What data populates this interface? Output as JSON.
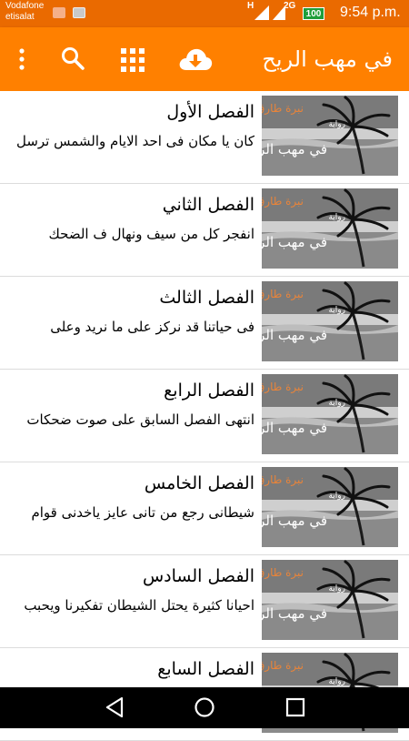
{
  "status_bar": {
    "carrier_line1": "Vodafone",
    "carrier_line2": "etisalat",
    "network_h": "H",
    "network_2g": "2G",
    "battery": "100",
    "time": "9:54 p.m."
  },
  "app_bar": {
    "title": "في مهب الريح",
    "icons": [
      "overflow-menu-icon",
      "search-icon",
      "grid-icon",
      "cloud-download-icon"
    ]
  },
  "chapters": [
    {
      "title": "الفصل الأول",
      "snippet": "كان يا مكان فى احد الايام والشمس ترسل"
    },
    {
      "title": "الفصل الثاني",
      "snippet": "انفجر كل من سيف ونهال ف الضحك"
    },
    {
      "title": "الفصل الثالث",
      "snippet": "فى حياتنا قد نركز على ما نريد وعلى"
    },
    {
      "title": "الفصل الرابع",
      "snippet": "انتهى الفصل السابق على صوت ضحكات"
    },
    {
      "title": "الفصل الخامس",
      "snippet": "شيطانى رجع من تانى عايز ياخدنى قوام"
    },
    {
      "title": "الفصل السادس",
      "snippet": "احيانا كثيرة يحتل الشيطان تفكيرنا ويحبب"
    },
    {
      "title": "الفصل السابع",
      "snippet": ""
    }
  ],
  "thumbnail_text": {
    "author": "نبرة طارق",
    "label": "رواية",
    "title": "في مهب الريح"
  },
  "colors": {
    "status_bar": "#ea6a00",
    "app_bar": "#ff8000",
    "accent_text": "#e8843a"
  }
}
